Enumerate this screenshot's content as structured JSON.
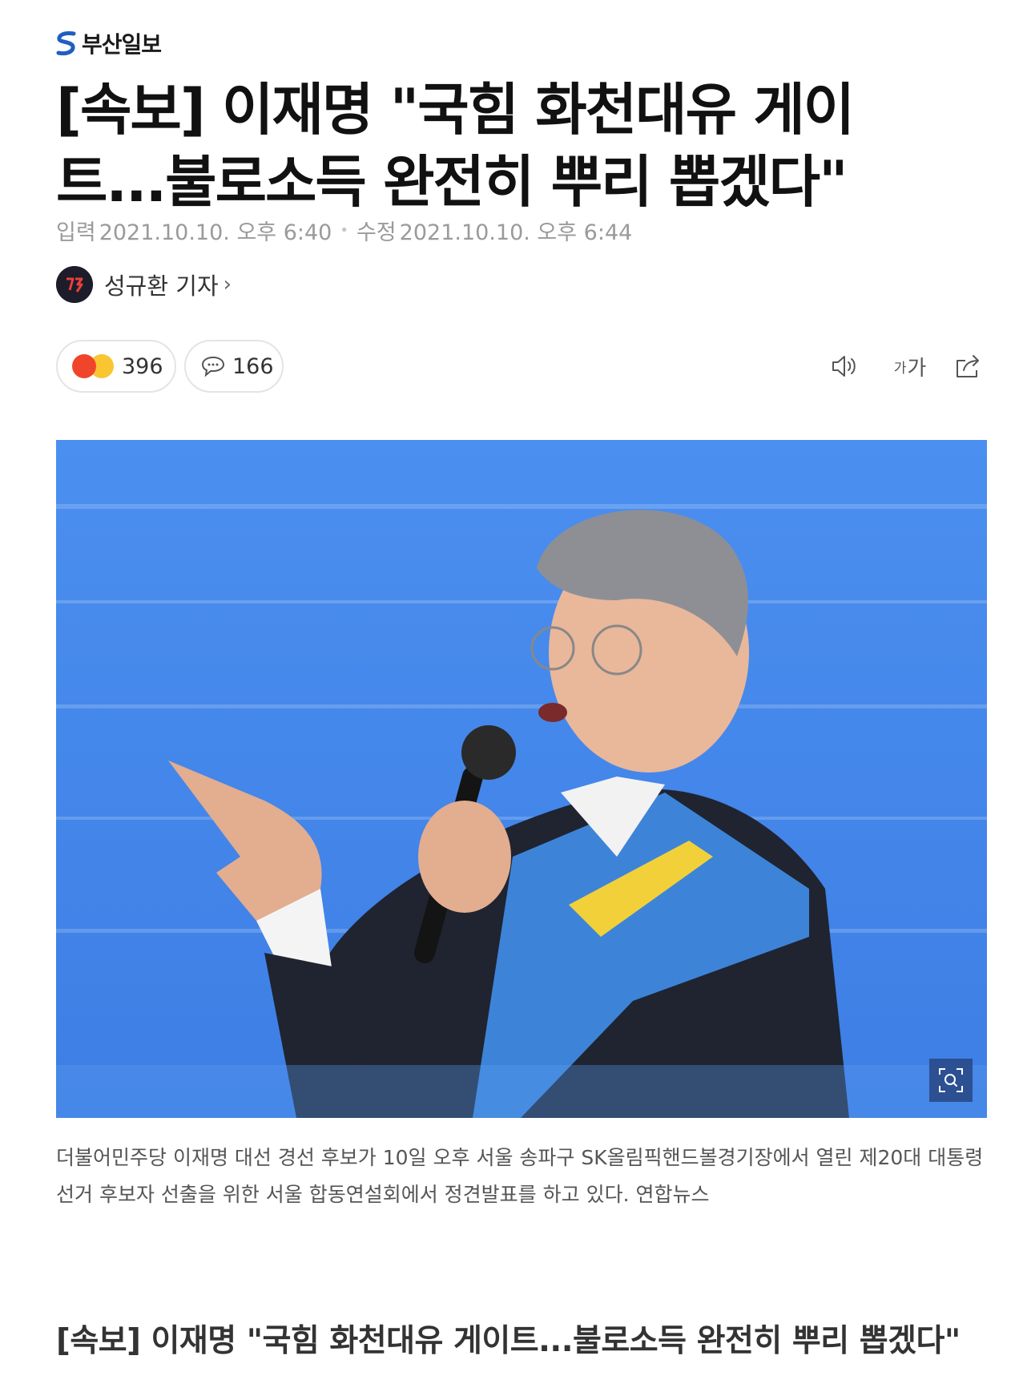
{
  "publisher": {
    "name": "부산일보",
    "logo_icon": "busan-ilbo-logo-icon"
  },
  "article": {
    "title": "[속보] 이재명 \"국힘 화천대유 게이트...불로소득 완전히 뿌리 뽑겠다\"",
    "input_label": "입력",
    "input_time": "2021.10.10. 오후 6:40",
    "modified_label": "수정",
    "modified_time": "2021.10.10. 오후 6:44",
    "reporter": "성규환 기자",
    "reporter_chevron": "›"
  },
  "actions": {
    "reaction_count": "396",
    "comment_count": "166",
    "font_small": "가",
    "font_large": "가",
    "reaction_icons": [
      "angry-emoji-icon",
      "laugh-emoji-icon"
    ],
    "tool_icons": [
      "comment-icon",
      "speaker-icon",
      "font-size-icon",
      "share-icon"
    ]
  },
  "photo": {
    "caption": "더불어민주당 이재명 대선 경선 후보가 10일 오후 서울 송파구 SK올림픽핸드볼경기장에서 열린 제20대 대통령선거 후보자 선출을 위한 서울 합동연설회에서 정견발표를 하고 있다. 연합뉴스",
    "zoom_icon": "zoom-icon"
  },
  "body": {
    "subheading": "[속보] 이재명 \"국힘 화천대유 게이트...불로소득 완전히 뿌리 뽑겠다\""
  },
  "colors": {
    "accent_blue": "#2a5bd7",
    "photo_background": "#4a8ee8",
    "angry_emoji": "#f0452b",
    "laugh_emoji": "#f9c531"
  }
}
